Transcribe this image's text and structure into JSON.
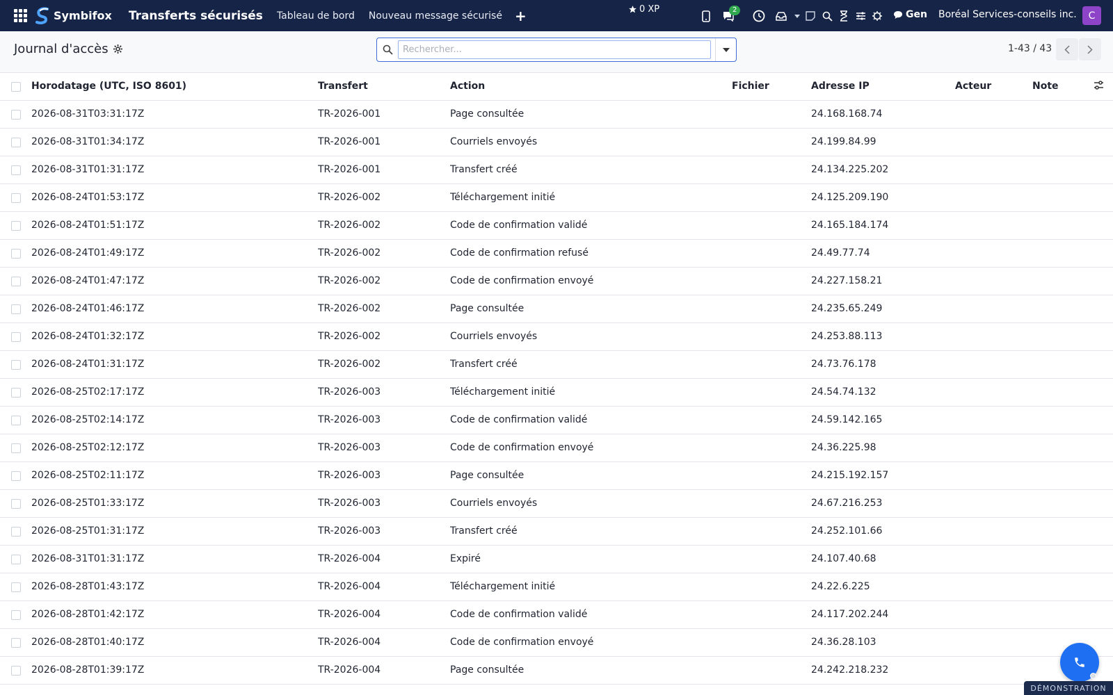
{
  "brand": {
    "name": "Symbifox"
  },
  "app": {
    "title": "Transferts sécurisés"
  },
  "nav": {
    "dashboard": "Tableau de bord",
    "new_message": "Nouveau message sécurisé"
  },
  "systray": {
    "xp": "0 XP",
    "messages_badge": "2",
    "gen_label": "Gen",
    "company": "Boréal Services-conseils inc.",
    "avatar_letter": "C",
    "icons": [
      "mobile-icon",
      "chat-icon",
      "clock-icon",
      "inbox-icon",
      "caret-icon",
      "note-icon",
      "search-icon",
      "hourglass-icon",
      "sliders-icon",
      "bug-icon"
    ]
  },
  "control": {
    "title": "Journal d'accès",
    "search_placeholder": "Rechercher...",
    "pager": "1-43 / 43"
  },
  "table": {
    "headers": {
      "timestamp": "Horodatage (UTC, ISO 8601)",
      "transfer": "Transfert",
      "action": "Action",
      "file": "Fichier",
      "ip": "Adresse IP",
      "actor": "Acteur",
      "note": "Note"
    },
    "rows": [
      {
        "ts": "2026-08-31T03:31:17Z",
        "tr": "TR-2026-001",
        "action": "Page consultée",
        "file": "",
        "ip": "24.168.168.74",
        "actor": "",
        "note": ""
      },
      {
        "ts": "2026-08-31T01:34:17Z",
        "tr": "TR-2026-001",
        "action": "Courriels envoyés",
        "file": "",
        "ip": "24.199.84.99",
        "actor": "",
        "note": ""
      },
      {
        "ts": "2026-08-31T01:31:17Z",
        "tr": "TR-2026-001",
        "action": "Transfert créé",
        "file": "",
        "ip": "24.134.225.202",
        "actor": "",
        "note": ""
      },
      {
        "ts": "2026-08-24T01:53:17Z",
        "tr": "TR-2026-002",
        "action": "Téléchargement initié",
        "file": "",
        "ip": "24.125.209.190",
        "actor": "",
        "note": ""
      },
      {
        "ts": "2026-08-24T01:51:17Z",
        "tr": "TR-2026-002",
        "action": "Code de confirmation validé",
        "file": "",
        "ip": "24.165.184.174",
        "actor": "",
        "note": ""
      },
      {
        "ts": "2026-08-24T01:49:17Z",
        "tr": "TR-2026-002",
        "action": "Code de confirmation refusé",
        "file": "",
        "ip": "24.49.77.74",
        "actor": "",
        "note": ""
      },
      {
        "ts": "2026-08-24T01:47:17Z",
        "tr": "TR-2026-002",
        "action": "Code de confirmation envoyé",
        "file": "",
        "ip": "24.227.158.21",
        "actor": "",
        "note": ""
      },
      {
        "ts": "2026-08-24T01:46:17Z",
        "tr": "TR-2026-002",
        "action": "Page consultée",
        "file": "",
        "ip": "24.235.65.249",
        "actor": "",
        "note": ""
      },
      {
        "ts": "2026-08-24T01:32:17Z",
        "tr": "TR-2026-002",
        "action": "Courriels envoyés",
        "file": "",
        "ip": "24.253.88.113",
        "actor": "",
        "note": ""
      },
      {
        "ts": "2026-08-24T01:31:17Z",
        "tr": "TR-2026-002",
        "action": "Transfert créé",
        "file": "",
        "ip": "24.73.76.178",
        "actor": "",
        "note": ""
      },
      {
        "ts": "2026-08-25T02:17:17Z",
        "tr": "TR-2026-003",
        "action": "Téléchargement initié",
        "file": "",
        "ip": "24.54.74.132",
        "actor": "",
        "note": ""
      },
      {
        "ts": "2026-08-25T02:14:17Z",
        "tr": "TR-2026-003",
        "action": "Code de confirmation validé",
        "file": "",
        "ip": "24.59.142.165",
        "actor": "",
        "note": ""
      },
      {
        "ts": "2026-08-25T02:12:17Z",
        "tr": "TR-2026-003",
        "action": "Code de confirmation envoyé",
        "file": "",
        "ip": "24.36.225.98",
        "actor": "",
        "note": ""
      },
      {
        "ts": "2026-08-25T02:11:17Z",
        "tr": "TR-2026-003",
        "action": "Page consultée",
        "file": "",
        "ip": "24.215.192.157",
        "actor": "",
        "note": ""
      },
      {
        "ts": "2026-08-25T01:33:17Z",
        "tr": "TR-2026-003",
        "action": "Courriels envoyés",
        "file": "",
        "ip": "24.67.216.253",
        "actor": "",
        "note": ""
      },
      {
        "ts": "2026-08-25T01:31:17Z",
        "tr": "TR-2026-003",
        "action": "Transfert créé",
        "file": "",
        "ip": "24.252.101.66",
        "actor": "",
        "note": ""
      },
      {
        "ts": "2026-08-31T01:31:17Z",
        "tr": "TR-2026-004",
        "action": "Expiré",
        "file": "",
        "ip": "24.107.40.68",
        "actor": "",
        "note": ""
      },
      {
        "ts": "2026-08-28T01:43:17Z",
        "tr": "TR-2026-004",
        "action": "Téléchargement initié",
        "file": "",
        "ip": "24.22.6.225",
        "actor": "",
        "note": ""
      },
      {
        "ts": "2026-08-28T01:42:17Z",
        "tr": "TR-2026-004",
        "action": "Code de confirmation validé",
        "file": "",
        "ip": "24.117.202.244",
        "actor": "",
        "note": ""
      },
      {
        "ts": "2026-08-28T01:40:17Z",
        "tr": "TR-2026-004",
        "action": "Code de confirmation envoyé",
        "file": "",
        "ip": "24.36.28.103",
        "actor": "",
        "note": ""
      },
      {
        "ts": "2026-08-28T01:39:17Z",
        "tr": "TR-2026-004",
        "action": "Page consultée",
        "file": "",
        "ip": "24.242.218.232",
        "actor": "",
        "note": ""
      }
    ]
  },
  "footer": {
    "demo_label": "DÉMONSTRATION"
  },
  "colors": {
    "navbar": "#162447",
    "accent": "#1f6ff2",
    "badge": "#2fa84f",
    "avatar": "#8e44c9"
  }
}
